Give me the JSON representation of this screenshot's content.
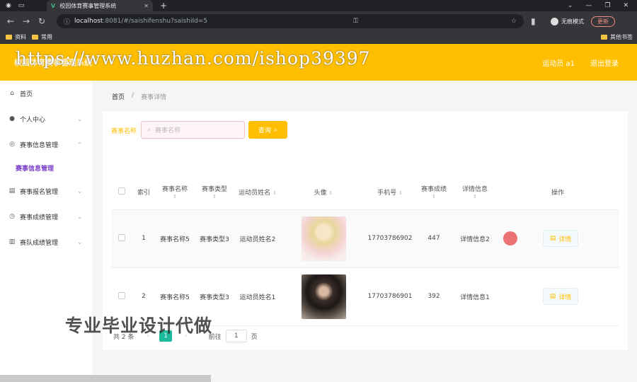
{
  "browser": {
    "tab_title": "校园体育赛事管理系统",
    "url_host": "localhost",
    "url_path": ":8081/#/saishifenshu?saishiId=5",
    "incognito_label": "无痕模式",
    "update_label": "更新",
    "bookmarks": [
      "资料",
      "常用"
    ],
    "bookmarks_right": "其他书签"
  },
  "header": {
    "site_title": "校园体育赛事管理系统",
    "user_label": "运动员 a1",
    "logout_label": "退出登录",
    "watermark": "https://www.huzhan.com/ishop39397"
  },
  "sidebar": {
    "items": [
      {
        "label": "首页",
        "icon": "home-icon",
        "glyph": "⌂"
      },
      {
        "label": "个人中心",
        "icon": "user-icon",
        "glyph": "●"
      },
      {
        "label": "赛事信息管理",
        "icon": "compass-icon",
        "glyph": "◎"
      },
      {
        "label": "赛事报名管理",
        "icon": "list-icon",
        "glyph": "▤"
      },
      {
        "label": "赛事成绩管理",
        "icon": "clock-icon",
        "glyph": "◷"
      },
      {
        "label": "赛队成绩管理",
        "icon": "doc-icon",
        "glyph": "▥"
      }
    ],
    "sub_item": "赛事信息管理"
  },
  "breadcrumb": {
    "home": "首页",
    "current": "赛事详情"
  },
  "search": {
    "label": "赛事名称",
    "placeholder": "赛事名称",
    "button": "查询"
  },
  "table": {
    "headers": [
      "索引",
      "赛事名称",
      "赛事类型",
      "运动员姓名",
      "头像",
      "手机号",
      "赛事成绩",
      "详情信息",
      "操作"
    ],
    "rows": [
      {
        "index": "1",
        "name": "赛事名称5",
        "type": "赛事类型3",
        "athlete": "运动员姓名2",
        "phone": "17703786902",
        "score": "447",
        "info": "详情信息2"
      },
      {
        "index": "2",
        "name": "赛事名称5",
        "type": "赛事类型3",
        "athlete": "运动员姓名1",
        "phone": "17703786901",
        "score": "392",
        "info": "详情信息1"
      }
    ],
    "detail_label": "详情"
  },
  "pagination": {
    "total": "共 2 条",
    "current": "1",
    "goto": "前往",
    "page_input": "1",
    "page_unit": "页"
  },
  "promo_text": "专业毕业设计代做",
  "colors": {
    "accent": "#ffbf00",
    "page_active": "#1abc9c"
  }
}
